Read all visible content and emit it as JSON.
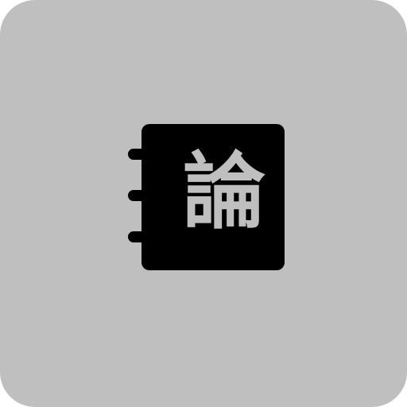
{
  "app": {
    "icon_name": "notebook-icon",
    "glyph": "論",
    "colors": {
      "tile_background": "#bfbfbf",
      "notebook_body": "#000000",
      "glyph": "#bfbfbf",
      "spiral_rings": "#000000"
    }
  }
}
